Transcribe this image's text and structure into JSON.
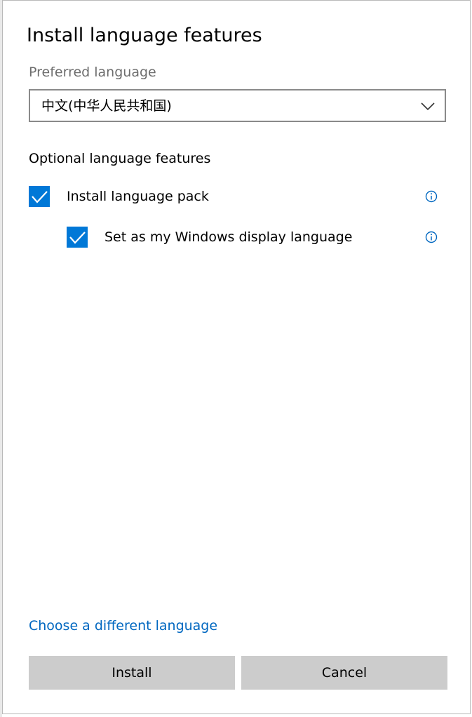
{
  "dialog": {
    "title": "Install language features",
    "preferred_language_label": "Preferred language",
    "preferred_language_value": "中文(中华人民共和国)",
    "optional_features_label": "Optional language features",
    "features": [
      {
        "label": "Install language pack",
        "checked": true
      },
      {
        "label": "Set as my Windows display language",
        "checked": true
      }
    ],
    "choose_link": "Choose a different language",
    "install_label": "Install",
    "cancel_label": "Cancel"
  },
  "colors": {
    "accent": "#0078d7",
    "link": "#0067c0",
    "button_bg": "#cccccc"
  },
  "icons": [
    "chevron-down-icon",
    "checkmark-icon",
    "info-icon"
  ]
}
